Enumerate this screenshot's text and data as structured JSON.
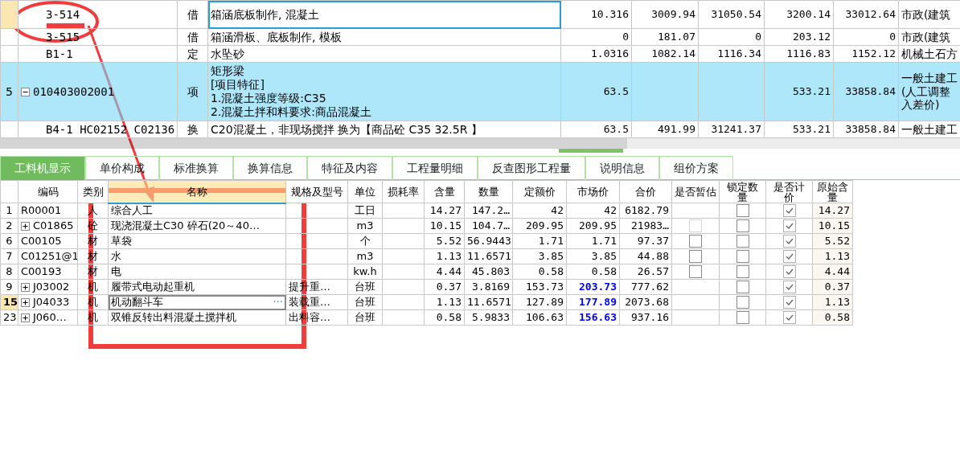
{
  "upper_grid": {
    "rows": [
      {
        "kind": "sub",
        "selected": true,
        "number": "",
        "code": "3-514",
        "type": "借",
        "name": "箱涵底板制作, 混凝土",
        "col_5": "10.316",
        "col_6": "3009.94",
        "col_7": "31050.54",
        "col_8": "3200.14",
        "col_9": "33012.64",
        "col_10": "市政(建筑"
      },
      {
        "kind": "sub",
        "selected": false,
        "number": "",
        "code": "3-515",
        "type": "借",
        "name": "箱涵滑板、底板制作, 模板",
        "col_5": "0",
        "col_6": "181.07",
        "col_7": "0",
        "col_8": "203.12",
        "col_9": "0",
        "col_10": "市政(建筑"
      },
      {
        "kind": "sub",
        "selected": false,
        "number": "",
        "code": "B1-1",
        "type": "定",
        "name": "水坠砂",
        "col_5": "1.0316",
        "col_6": "1082.14",
        "col_7": "1116.34",
        "col_8": "1116.83",
        "col_9": "1152.12",
        "col_10": "机械土石方"
      },
      {
        "kind": "item",
        "selected": false,
        "expanded": true,
        "number": "5",
        "code": "010403002001",
        "type": "项",
        "name": "矩形梁\n[项目特征]\n1.混凝土强度等级:C35\n2.混凝土拌和料要求:商品混凝土",
        "col_5": "63.5",
        "col_6": "",
        "col_7": "",
        "col_8": "533.21",
        "col_9": "33858.84",
        "col_10": "一般土建工(人工调整入差价)"
      },
      {
        "kind": "sub",
        "selected": false,
        "number": "",
        "code": "B4-1 HC02152 C02136",
        "type": "换",
        "name": "C20混凝土，非现场搅拌  换为【商品砼 C35 32.5R 】",
        "col_5": "63.5",
        "col_6": "491.99",
        "col_7": "31241.37",
        "col_8": "533.21",
        "col_9": "33858.84",
        "col_10": "一般土建工"
      }
    ]
  },
  "tabs": [
    {
      "label": "工料机显示",
      "selected": true
    },
    {
      "label": "单价构成",
      "selected": false
    },
    {
      "label": "标准换算",
      "selected": false
    },
    {
      "label": "换算信息",
      "selected": false
    },
    {
      "label": "特征及内容",
      "selected": false
    },
    {
      "label": "工程量明细",
      "selected": false
    },
    {
      "label": "反查图形工程量",
      "selected": false
    },
    {
      "label": "说明信息",
      "selected": false
    },
    {
      "label": "组价方案",
      "selected": false
    }
  ],
  "lower_grid": {
    "columns": [
      "编码",
      "类别",
      "名称",
      "规格及型号",
      "单位",
      "损耗率",
      "含量",
      "数量",
      "定额价",
      "市场价",
      "合价",
      "是否暂估",
      "锁定数量",
      "是否计价",
      "原始含量"
    ],
    "rows": [
      {
        "selected": false,
        "number": "1",
        "code": "R00001",
        "expandable": false,
        "type": "人",
        "name": "综合人工",
        "spec": "",
        "unit": "工日",
        "content": "14.27",
        "quantity": "147.2…",
        "quota_price": "42",
        "market_price": "42",
        "price_adjusted": false,
        "total": "6182.79",
        "estimate": null,
        "lock_quantity": false,
        "priced": true,
        "original_content": "14.27"
      },
      {
        "selected": false,
        "number": "2",
        "code": "C01865",
        "expandable": true,
        "type": "砼",
        "name": "现浇混凝土C30 碎石(20～40…",
        "spec": "",
        "unit": "m3",
        "content": "10.15",
        "quantity": "104.7…",
        "quota_price": "209.95",
        "market_price": "209.95",
        "price_adjusted": false,
        "total": "21983…",
        "estimate": false,
        "estimate_disabled": true,
        "lock_quantity": false,
        "priced": true,
        "original_content": "10.15"
      },
      {
        "selected": false,
        "number": "6",
        "code": "C00105",
        "expandable": false,
        "type": "材",
        "name": "草袋",
        "spec": "",
        "unit": "个",
        "content": "5.52",
        "quantity": "56.9443",
        "quota_price": "1.71",
        "market_price": "1.71",
        "price_adjusted": false,
        "total": "97.37",
        "estimate": false,
        "estimate_disabled": false,
        "lock_quantity": false,
        "priced": true,
        "original_content": "5.52"
      },
      {
        "selected": false,
        "number": "7",
        "code": "C01251@1",
        "expandable": false,
        "type": "材",
        "name": "水",
        "spec": "",
        "unit": "m3",
        "content": "1.13",
        "quantity": "11.6571",
        "quota_price": "3.85",
        "market_price": "3.85",
        "price_adjusted": false,
        "total": "44.88",
        "estimate": false,
        "estimate_disabled": false,
        "lock_quantity": false,
        "priced": true,
        "original_content": "1.13"
      },
      {
        "selected": false,
        "number": "8",
        "code": "C00193",
        "expandable": false,
        "type": "材",
        "name": "电",
        "spec": "",
        "unit": "kw.h",
        "content": "4.44",
        "quantity": "45.803",
        "quota_price": "0.58",
        "market_price": "0.58",
        "price_adjusted": false,
        "total": "26.57",
        "estimate": false,
        "estimate_disabled": false,
        "lock_quantity": false,
        "priced": true,
        "original_content": "4.44"
      },
      {
        "selected": false,
        "number": "9",
        "code": "J03002",
        "expandable": true,
        "type": "机",
        "name": "履带式电动起重机",
        "spec": "提升重…",
        "unit": "台班",
        "content": "0.37",
        "quantity": "3.8169",
        "quota_price": "153.73",
        "market_price": "203.73",
        "price_adjusted": true,
        "total": "777.62",
        "estimate": null,
        "lock_quantity": false,
        "priced": true,
        "original_content": "0.37"
      },
      {
        "selected": true,
        "number": "15",
        "code": "J04033",
        "expandable": true,
        "type": "机",
        "name": "机动翻斗车",
        "edit_button": "···",
        "spec": "装载重…",
        "unit": "台班",
        "content": "1.13",
        "quantity": "11.6571",
        "quota_price": "127.89",
        "market_price": "177.89",
        "price_adjusted": true,
        "total": "2073.68",
        "estimate": null,
        "lock_quantity": false,
        "priced": true,
        "original_content": "1.13"
      },
      {
        "selected": false,
        "number": "23",
        "code": "J060…",
        "expandable": true,
        "type": "机",
        "name": "双锥反转出料混凝土搅拌机",
        "spec": "出料容…",
        "unit": "台班",
        "content": "0.58",
        "quantity": "5.9833",
        "quota_price": "106.63",
        "market_price": "156.63",
        "price_adjusted": true,
        "total": "937.16",
        "estimate": null,
        "lock_quantity": false,
        "priced": true,
        "original_content": "0.58"
      }
    ]
  }
}
